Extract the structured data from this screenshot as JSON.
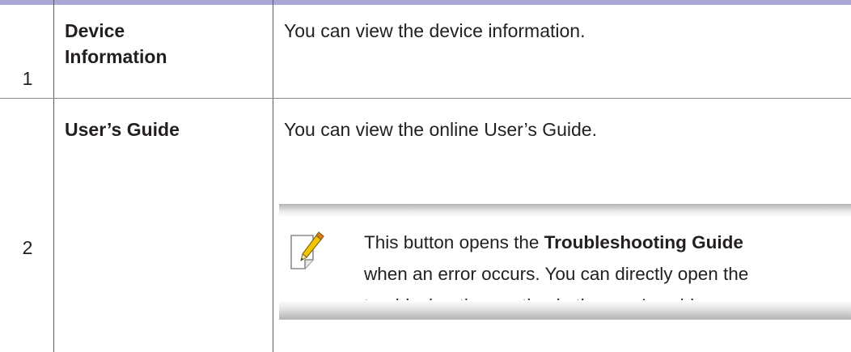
{
  "rows": [
    {
      "number": "1",
      "term_line1": "Device",
      "term_line2": "Information",
      "description": "You can view the device information."
    },
    {
      "number": "2",
      "term": "User’s Guide",
      "description": "You can view the online User’s Guide.",
      "note": {
        "icon": "note-pencil-icon",
        "text_before": "This button opens the ",
        "text_bold": "Troubleshooting Guide",
        "line2": "when an error occurs. You can directly open the",
        "line3": "troubleshooting section in the user’s guide."
      }
    }
  ],
  "colors": {
    "header_bar": "#a9a6d6",
    "text": "#231f20",
    "note_gradient": "#b3b3b3",
    "icon_accent": "#f5c400"
  }
}
